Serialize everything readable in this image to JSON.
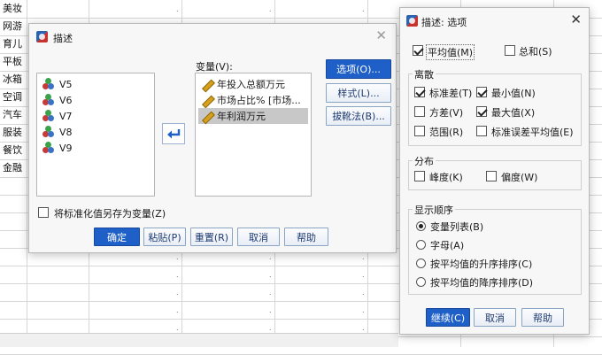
{
  "sheet": {
    "row_labels": [
      "美妆",
      "网游",
      "育儿",
      "平板",
      "冰箱",
      "空调",
      "汽车",
      "服装",
      "餐饮",
      "金融"
    ],
    "cell_dot": "."
  },
  "describe_dialog": {
    "title": "描述",
    "variables_label": "变量(V):",
    "source_vars": [
      "V5",
      "V6",
      "V7",
      "V8",
      "V9"
    ],
    "target_vars": [
      "年投入总额万元",
      "市场占比% [市场...",
      "年利润万元"
    ],
    "buttons": {
      "options": "选项(O)...",
      "style": "样式(L)...",
      "bootstrap": "拔靴法(B)...",
      "ok": "确定",
      "paste": "粘贴(P)",
      "reset": "重置(R)",
      "cancel": "取消",
      "help": "帮助"
    },
    "save_standardized": "将标准化值另存为变量(Z)"
  },
  "options_dialog": {
    "title": "描述: 选项",
    "mean": "平均值(M)",
    "sum": "总和(S)",
    "dispersion": {
      "title": "离散",
      "std_dev": "标准差(T)",
      "minimum": "最小值(N)",
      "variance": "方差(V)",
      "maximum": "最大值(X)",
      "range": "范围(R)",
      "se_mean": "标准误差平均值(E)"
    },
    "distribution": {
      "title": "分布",
      "kurtosis": "峰度(K)",
      "skewness": "偏度(W)"
    },
    "display_order": {
      "title": "显示顺序",
      "variable_list": "变量列表(B)",
      "alphabetic": "字母(A)",
      "ascending_means": "按平均值的升序排序(C)",
      "descending_means": "按平均值的降序排序(D)"
    },
    "buttons": {
      "continue": "继续(C)",
      "cancel": "取消",
      "help": "帮助"
    }
  },
  "colors": {
    "primary_button": "#1f5fc8",
    "selection_gray": "#c8c8c8"
  }
}
